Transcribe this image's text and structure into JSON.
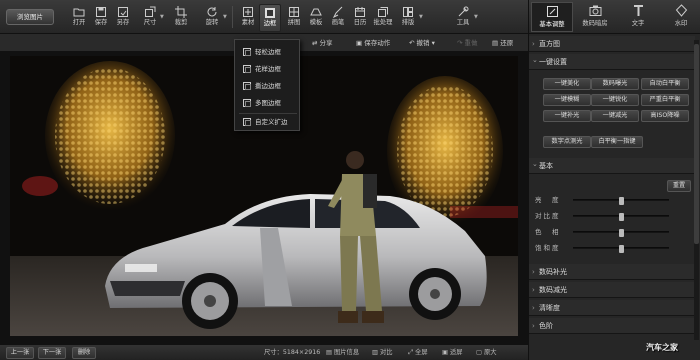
{
  "topbar": {
    "browse_label": "浏览图片",
    "tools": [
      {
        "label": "打开",
        "icon": "open-icon"
      },
      {
        "label": "保存",
        "icon": "save-icon"
      },
      {
        "label": "另存",
        "icon": "save-as-icon"
      },
      {
        "label": "尺寸",
        "icon": "resize-icon"
      },
      {
        "label": "裁剪",
        "icon": "crop-icon"
      },
      {
        "label": "旋转",
        "icon": "rotate-icon"
      },
      {
        "label": "素材",
        "icon": "material-icon"
      },
      {
        "label": "边框",
        "icon": "frame-icon",
        "active": true
      },
      {
        "label": "拼图",
        "icon": "collage-icon"
      },
      {
        "label": "模板",
        "icon": "template-icon"
      },
      {
        "label": "画笔",
        "icon": "brush-icon"
      },
      {
        "label": "日历",
        "icon": "calendar-icon"
      },
      {
        "label": "批处理",
        "icon": "batch-icon"
      },
      {
        "label": "排版",
        "icon": "layout-icon"
      },
      {
        "label": "工具",
        "icon": "tools-icon"
      }
    ]
  },
  "actionbar": {
    "share": "分享",
    "save_action": "保存动作",
    "undo": "撤销",
    "redo": "重做",
    "restore": "还原"
  },
  "dropdown": {
    "items": [
      "轻松边框",
      "花样边框",
      "撕边边框",
      "多图边框",
      "自定义扩边"
    ]
  },
  "right_tabs": [
    {
      "label": "基本调整",
      "icon": "adjust-icon",
      "active": true
    },
    {
      "label": "数码暗房",
      "icon": "camera-icon"
    },
    {
      "label": "文字",
      "icon": "text-icon"
    },
    {
      "label": "水印",
      "icon": "watermark-icon"
    }
  ],
  "panel": {
    "histogram": "直方图",
    "one_click": "一键设置",
    "quick_buttons": [
      "一键美化",
      "数码曝光",
      "自动白平衡",
      "一键模糊",
      "一键锐化",
      "严重白平衡",
      "一键补光",
      "一键减光",
      "高ISO降噪"
    ],
    "extra_buttons": [
      "数字点测光",
      "白平衡一指键"
    ],
    "basic": "基本",
    "reset": "重置",
    "sliders": [
      {
        "label": "亮　度",
        "value": 0.5
      },
      {
        "label": "对比度",
        "value": 0.5
      },
      {
        "label": "色　相",
        "value": 0.5
      },
      {
        "label": "饱和度",
        "value": 0.5
      }
    ],
    "sections": [
      "数码补光",
      "数码减光",
      "清晰度",
      "色阶"
    ]
  },
  "status": {
    "prev": "上一张",
    "next": "下一张",
    "delete": "删除",
    "size": "尺寸：5184×2916",
    "info": "图片信息",
    "compare": "对比",
    "fullscreen": "全屏",
    "fit": "适屏",
    "original": "原大"
  },
  "watermark": "汽车之家"
}
